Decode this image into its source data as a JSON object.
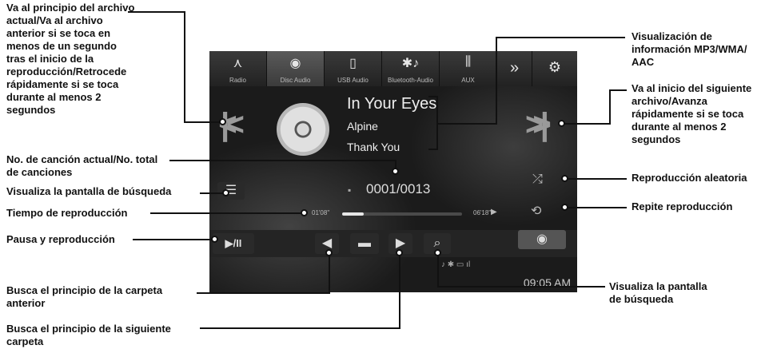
{
  "tabs": [
    {
      "label": "Radio",
      "icon": "antenna-icon"
    },
    {
      "label": "Disc Audio",
      "icon": "disc-icon"
    },
    {
      "label": "USB Audio",
      "icon": "usb-icon"
    },
    {
      "label": "Bluetooth-Audio",
      "icon": "bluetooth-icon"
    },
    {
      "label": "AUX",
      "icon": "aux-icon"
    }
  ],
  "more_icon": "»",
  "track": {
    "title": "In Your Eyes",
    "artist": "Alpine",
    "album": "Thank You"
  },
  "track_number": "0001/0013",
  "time": {
    "elapsed": "01'08\"",
    "total": "06'18\""
  },
  "progress_fraction": 0.18,
  "clock": "09:05 AM",
  "callouts": {
    "prev_file": [
      "Va al principio del archivo",
      "actual/Va al archivo",
      "anterior si se toca en",
      "menos de un segundo",
      "tras el inicio de la",
      "reproducción/Retrocede",
      "rápidamente si se toca",
      "durante al menos 2",
      "segundos"
    ],
    "track_count": [
      "No. de canción actual/No. total",
      "de canciones"
    ],
    "search_screen_left": [
      "Visualiza la pantalla de búsqueda"
    ],
    "play_time": [
      "Tiempo de reproducción"
    ],
    "pause_play": [
      "Pausa y reproducción"
    ],
    "prev_folder": [
      "Busca el principio de la carpeta",
      "anterior"
    ],
    "next_folder": [
      "Busca el principio de la siguiente",
      "carpeta"
    ],
    "info_display": [
      "Visualización de",
      "información MP3/WMA/",
      "AAC"
    ],
    "next_file": [
      "Va al inicio del siguiente",
      "archivo/Avanza",
      "rápidamente si se toca",
      "durante al menos 2",
      "segundos"
    ],
    "shuffle": [
      "Reproducción aleatoria"
    ],
    "repeat": [
      "Repite reproducción"
    ],
    "search_screen_right": [
      "Visualiza la pantalla",
      "de búsqueda"
    ]
  }
}
